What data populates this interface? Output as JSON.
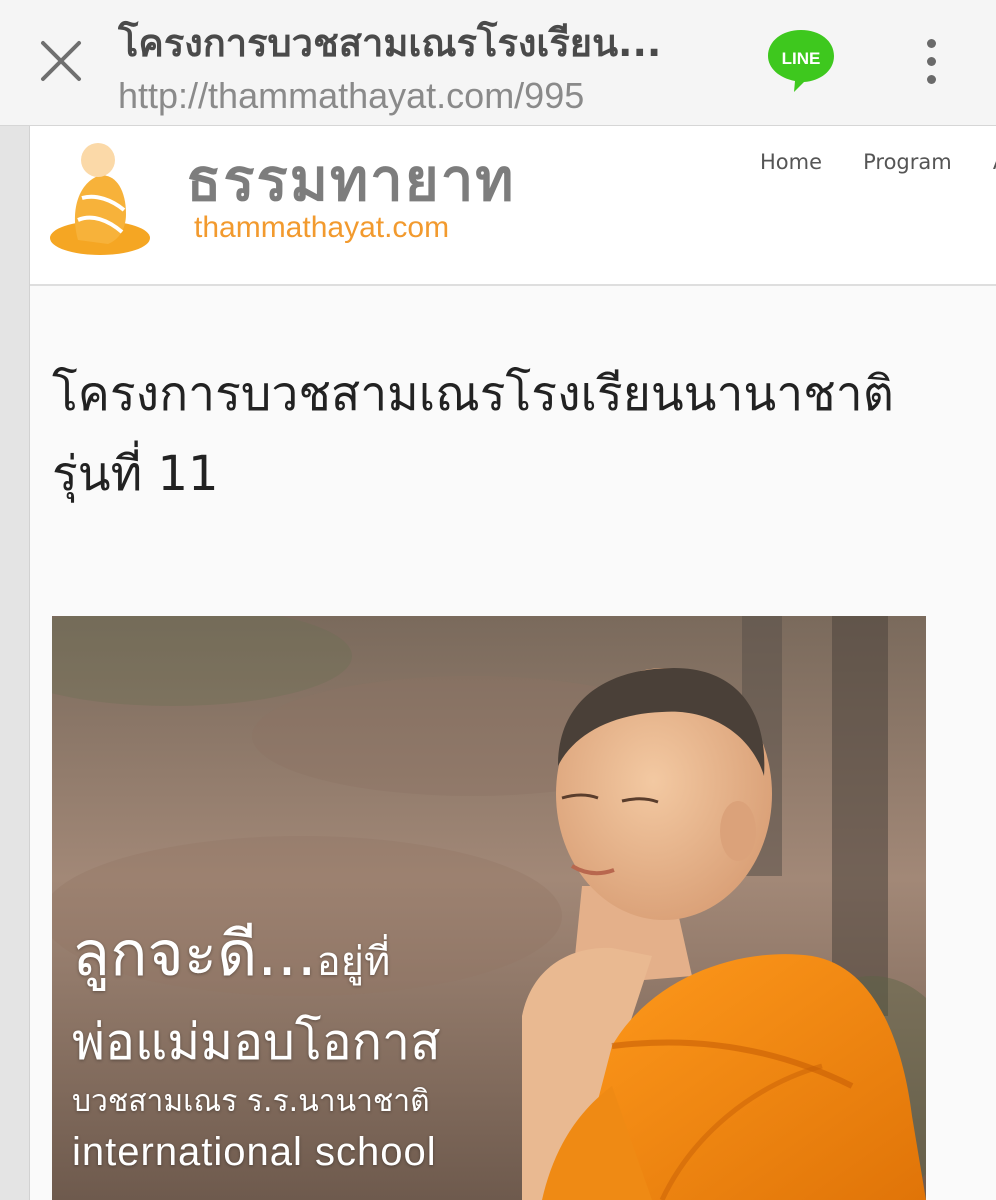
{
  "colors": {
    "appbar_bg": "#f5f5f5",
    "line_green": "#3ec81e",
    "logo_orange": "#f5a623",
    "logo_gray": "#7d7d7d",
    "robe_orange": "#f08a12"
  },
  "appbar": {
    "close_icon": "close-icon",
    "title": "โครงการบวชสามเณรโรงเรียน...",
    "url": "http://thammathayat.com/995",
    "line_label": "LINE",
    "more_icon": "more-vertical-icon"
  },
  "site": {
    "logo_title": "ธรรมทายาท",
    "logo_sub": "thammathayat.com",
    "nav": [
      {
        "label": "Home"
      },
      {
        "label": "Program"
      },
      {
        "label": "A"
      }
    ]
  },
  "post": {
    "title": "โครงการบวชสามเณรโรงเรียนนานาชาติ รุ่นที่ 11"
  },
  "hero": {
    "line1_big": "ลูกจะดี...",
    "line1_small": "อยู่ที่",
    "line2": "พ่อแม่มอบโอกาส",
    "line3": "บวชสามเณร ร.ร.นานาชาติ",
    "line4": "international school"
  }
}
